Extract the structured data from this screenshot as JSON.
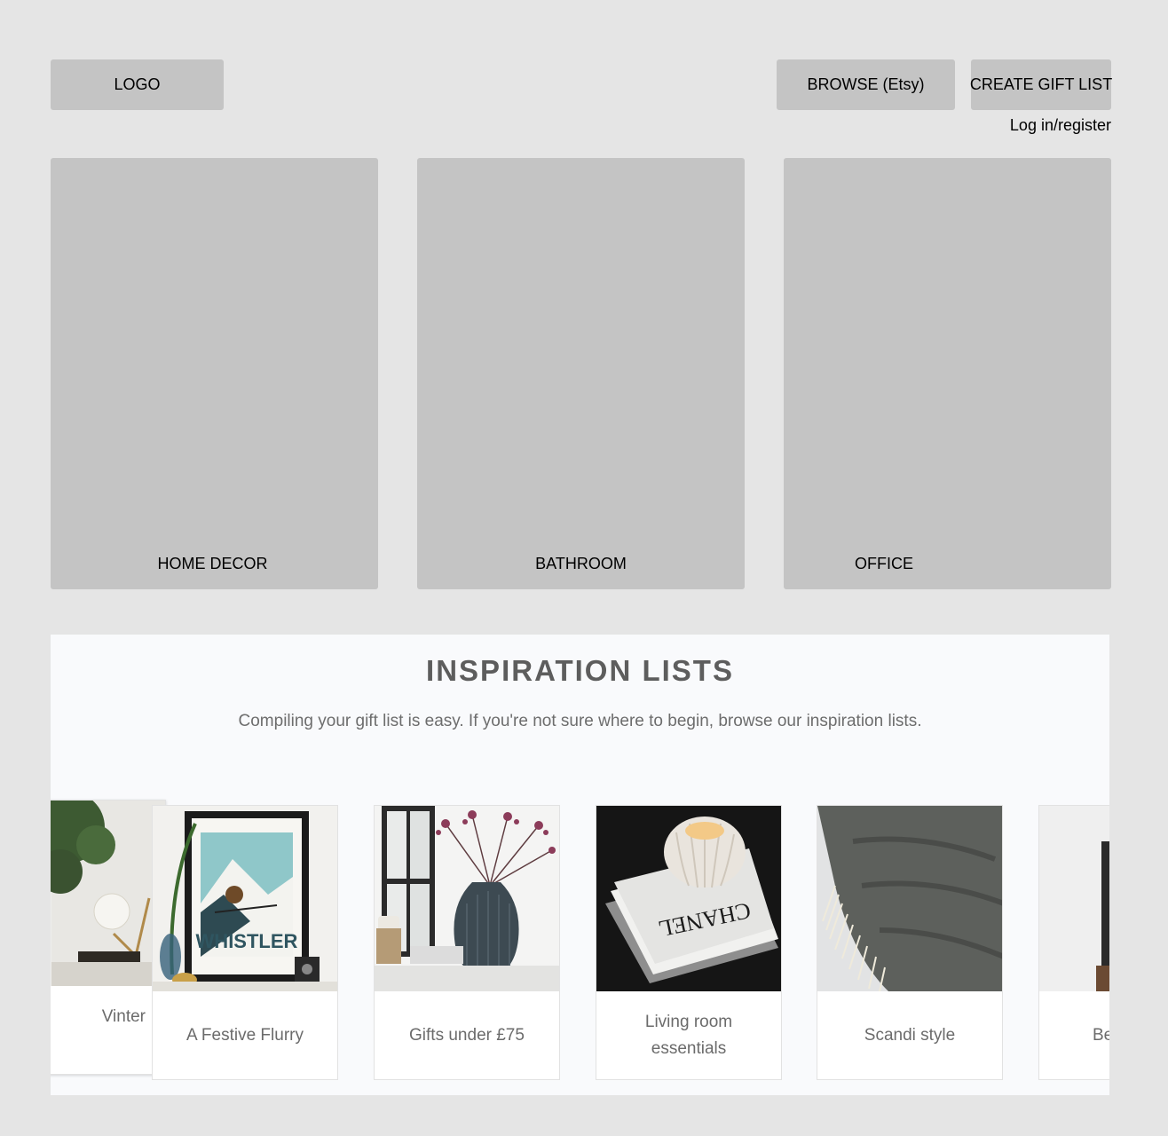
{
  "header": {
    "logo_label": "LOGO",
    "browse_label": "BROWSE (Etsy)",
    "create_label": "CREATE GIFT LIST",
    "login_label": "Log in/register"
  },
  "categories": [
    {
      "label": "HOME DECOR"
    },
    {
      "label": "BATHROOM"
    },
    {
      "label": "OFFICE"
    }
  ],
  "inspiration": {
    "title": "INSPIRATION LISTS",
    "subtitle": "Compiling your gift list is easy. If you're not sure where to begin, browse our inspiration lists.",
    "cards": [
      {
        "label": "Vinter",
        "image": "winter-decor-photo"
      },
      {
        "label": "A Festive Flurry",
        "image": "whistler-poster-photo"
      },
      {
        "label": "Gifts under £75",
        "image": "vase-flowers-photo"
      },
      {
        "label": "Living room essentials",
        "image": "candle-on-books-photo"
      },
      {
        "label": "Scandi style",
        "image": "grey-throw-blanket-photo"
      },
      {
        "label": "Be up",
        "image": "partial-photo"
      }
    ]
  },
  "colors": {
    "page_bg": "#e5e5e5",
    "placeholder": "#c4c4c4",
    "panel_bg": "#f9fafc",
    "title_text": "#5d5d5d",
    "muted_text": "#6b6b6b"
  }
}
